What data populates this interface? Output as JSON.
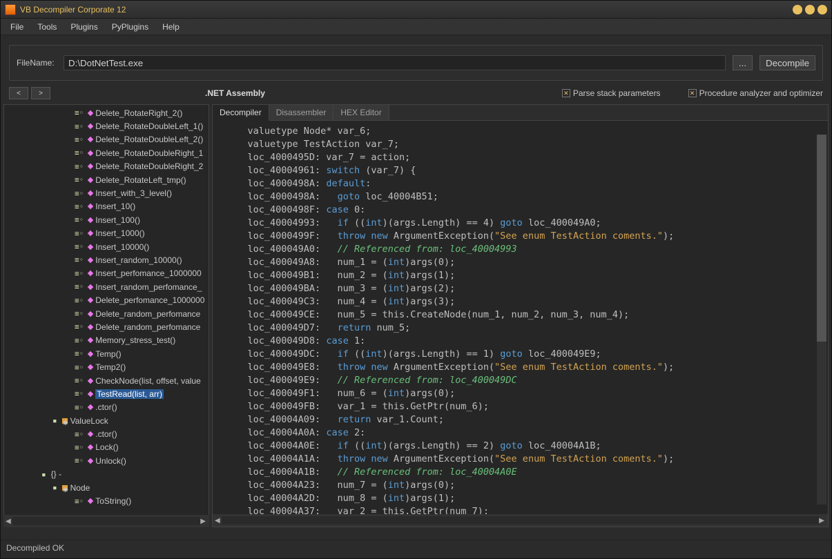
{
  "window": {
    "title": "VB Decompiler Corporate 12"
  },
  "menu": [
    "File",
    "Tools",
    "Plugins",
    "PyPlugins",
    "Help"
  ],
  "filePanel": {
    "label": "FileName:",
    "value": "D:\\DotNetTest.exe",
    "browse": "...",
    "decompile": "Decompile"
  },
  "infoBar": {
    "back": "<",
    "fwd": ">",
    "assembly": ".NET Assembly",
    "check1": "Parse stack parameters",
    "check2": "Procedure analyzer and optimizer"
  },
  "tree": [
    {
      "t": "Delete_RotateRight_2()",
      "k": "m",
      "l": 3
    },
    {
      "t": "Delete_RotateDoubleLeft_1()",
      "k": "m",
      "l": 3
    },
    {
      "t": "Delete_RotateDoubleLeft_2()",
      "k": "m",
      "l": 3
    },
    {
      "t": "Delete_RotateDoubleRight_1",
      "k": "m",
      "l": 3
    },
    {
      "t": "Delete_RotateDoubleRight_2",
      "k": "m",
      "l": 3
    },
    {
      "t": "Delete_RotateLeft_tmp()",
      "k": "m",
      "l": 3
    },
    {
      "t": "Insert_with_3_level()",
      "k": "m",
      "l": 3
    },
    {
      "t": "Insert_10()",
      "k": "m",
      "l": 3
    },
    {
      "t": "Insert_100()",
      "k": "m",
      "l": 3
    },
    {
      "t": "Insert_1000()",
      "k": "m",
      "l": 3
    },
    {
      "t": "Insert_10000()",
      "k": "m",
      "l": 3
    },
    {
      "t": "Insert_random_10000()",
      "k": "m",
      "l": 3
    },
    {
      "t": "Insert_perfomance_1000000",
      "k": "m",
      "l": 3
    },
    {
      "t": "Insert_random_perfomance_",
      "k": "m",
      "l": 3
    },
    {
      "t": "Delete_perfomance_1000000",
      "k": "m",
      "l": 3
    },
    {
      "t": "Delete_random_perfomance",
      "k": "m",
      "l": 3
    },
    {
      "t": "Delete_random_perfomance",
      "k": "m",
      "l": 3
    },
    {
      "t": "Memory_stress_test()",
      "k": "m",
      "l": 3
    },
    {
      "t": "Temp()",
      "k": "m",
      "l": 3
    },
    {
      "t": "Temp2()",
      "k": "m",
      "l": 3
    },
    {
      "t": "CheckNode(list, offset, value",
      "k": "m",
      "l": 3
    },
    {
      "t": "TestRead(list, arr)",
      "k": "m",
      "l": 3,
      "sel": true
    },
    {
      "t": ".ctor()",
      "k": "m",
      "l": 3
    },
    {
      "t": "ValueLock",
      "k": "c",
      "l": 2
    },
    {
      "t": ".ctor()",
      "k": "m",
      "l": 3
    },
    {
      "t": "Lock()",
      "k": "m",
      "l": 3
    },
    {
      "t": "Unlock()",
      "k": "m",
      "l": 3
    },
    {
      "t": "{} -",
      "k": "ns",
      "l": 1
    },
    {
      "t": "Node",
      "k": "c",
      "l": 2
    },
    {
      "t": "ToString()",
      "k": "m",
      "l": 3
    }
  ],
  "tabs": [
    "Decompiler",
    "Disassembler",
    "HEX Editor"
  ],
  "activeTab": 0,
  "code": [
    {
      "ind": 4,
      "seg": [
        {
          "c": "lb",
          "t": "valuetype Node* var_6;"
        }
      ]
    },
    {
      "ind": 4,
      "seg": [
        {
          "c": "lb",
          "t": "valuetype TestAction var_7;"
        }
      ]
    },
    {
      "ind": 0,
      "seg": [
        {
          "c": "lb",
          "t": ""
        }
      ]
    },
    {
      "ind": 4,
      "seg": [
        {
          "c": "lb",
          "t": "loc_4000495D: var_7 = action;"
        }
      ]
    },
    {
      "ind": 4,
      "seg": [
        {
          "c": "lb",
          "t": "loc_40004961: "
        },
        {
          "c": "kw",
          "t": "switch"
        },
        {
          "c": "lb",
          "t": " (var_7) {"
        }
      ]
    },
    {
      "ind": 4,
      "seg": [
        {
          "c": "lb",
          "t": "loc_4000498A: "
        },
        {
          "c": "kw",
          "t": "default"
        },
        {
          "c": "lb",
          "t": ":"
        }
      ]
    },
    {
      "ind": 4,
      "seg": [
        {
          "c": "lb",
          "t": "loc_4000498A:   "
        },
        {
          "c": "kw",
          "t": "goto"
        },
        {
          "c": "lb",
          "t": " loc_40004B51;"
        }
      ]
    },
    {
      "ind": 4,
      "seg": [
        {
          "c": "lb",
          "t": "loc_4000498F: "
        },
        {
          "c": "kw",
          "t": "case"
        },
        {
          "c": "lb",
          "t": " 0:"
        }
      ]
    },
    {
      "ind": 4,
      "seg": [
        {
          "c": "lb",
          "t": "loc_40004993:   "
        },
        {
          "c": "kw",
          "t": "if"
        },
        {
          "c": "lb",
          "t": " (("
        },
        {
          "c": "kw",
          "t": "int"
        },
        {
          "c": "lb",
          "t": ")(args.Length) == 4) "
        },
        {
          "c": "kw",
          "t": "goto"
        },
        {
          "c": "lb",
          "t": " loc_400049A0;"
        }
      ]
    },
    {
      "ind": 4,
      "seg": [
        {
          "c": "lb",
          "t": "loc_4000499F:   "
        },
        {
          "c": "kw",
          "t": "throw"
        },
        {
          "c": "lb",
          "t": " "
        },
        {
          "c": "kw",
          "t": "new"
        },
        {
          "c": "lb",
          "t": " ArgumentException("
        },
        {
          "c": "str",
          "t": "\"See enum TestAction coments.\""
        },
        {
          "c": "lb",
          "t": ");"
        }
      ]
    },
    {
      "ind": 4,
      "seg": [
        {
          "c": "lb",
          "t": "loc_400049A0:   "
        },
        {
          "c": "cmt",
          "t": "// Referenced from: loc_40004993"
        }
      ]
    },
    {
      "ind": 4,
      "seg": [
        {
          "c": "lb",
          "t": "loc_400049A8:   num_1 = ("
        },
        {
          "c": "kw",
          "t": "int"
        },
        {
          "c": "lb",
          "t": ")args(0);"
        }
      ]
    },
    {
      "ind": 4,
      "seg": [
        {
          "c": "lb",
          "t": "loc_400049B1:   num_2 = ("
        },
        {
          "c": "kw",
          "t": "int"
        },
        {
          "c": "lb",
          "t": ")args(1);"
        }
      ]
    },
    {
      "ind": 4,
      "seg": [
        {
          "c": "lb",
          "t": "loc_400049BA:   num_3 = ("
        },
        {
          "c": "kw",
          "t": "int"
        },
        {
          "c": "lb",
          "t": ")args(2);"
        }
      ]
    },
    {
      "ind": 4,
      "seg": [
        {
          "c": "lb",
          "t": "loc_400049C3:   num_4 = ("
        },
        {
          "c": "kw",
          "t": "int"
        },
        {
          "c": "lb",
          "t": ")args(3);"
        }
      ]
    },
    {
      "ind": 4,
      "seg": [
        {
          "c": "lb",
          "t": "loc_400049CE:   num_5 = this.CreateNode(num_1, num_2, num_3, num_4);"
        }
      ]
    },
    {
      "ind": 4,
      "seg": [
        {
          "c": "lb",
          "t": "loc_400049D7:   "
        },
        {
          "c": "kw",
          "t": "return"
        },
        {
          "c": "lb",
          "t": " num_5;"
        }
      ]
    },
    {
      "ind": 4,
      "seg": [
        {
          "c": "lb",
          "t": "loc_400049D8: "
        },
        {
          "c": "kw",
          "t": "case"
        },
        {
          "c": "lb",
          "t": " 1:"
        }
      ]
    },
    {
      "ind": 4,
      "seg": [
        {
          "c": "lb",
          "t": "loc_400049DC:   "
        },
        {
          "c": "kw",
          "t": "if"
        },
        {
          "c": "lb",
          "t": " (("
        },
        {
          "c": "kw",
          "t": "int"
        },
        {
          "c": "lb",
          "t": ")(args.Length) == 1) "
        },
        {
          "c": "kw",
          "t": "goto"
        },
        {
          "c": "lb",
          "t": " loc_400049E9;"
        }
      ]
    },
    {
      "ind": 4,
      "seg": [
        {
          "c": "lb",
          "t": "loc_400049E8:   "
        },
        {
          "c": "kw",
          "t": "throw"
        },
        {
          "c": "lb",
          "t": " "
        },
        {
          "c": "kw",
          "t": "new"
        },
        {
          "c": "lb",
          "t": " ArgumentException("
        },
        {
          "c": "str",
          "t": "\"See enum TestAction coments.\""
        },
        {
          "c": "lb",
          "t": ");"
        }
      ]
    },
    {
      "ind": 4,
      "seg": [
        {
          "c": "lb",
          "t": "loc_400049E9:   "
        },
        {
          "c": "cmt",
          "t": "// Referenced from: loc_400049DC"
        }
      ]
    },
    {
      "ind": 4,
      "seg": [
        {
          "c": "lb",
          "t": "loc_400049F1:   num_6 = ("
        },
        {
          "c": "kw",
          "t": "int"
        },
        {
          "c": "lb",
          "t": ")args(0);"
        }
      ]
    },
    {
      "ind": 4,
      "seg": [
        {
          "c": "lb",
          "t": "loc_400049FB:   var_1 = this.GetPtr(num_6);"
        }
      ]
    },
    {
      "ind": 4,
      "seg": [
        {
          "c": "lb",
          "t": "loc_40004A09:   "
        },
        {
          "c": "kw",
          "t": "return"
        },
        {
          "c": "lb",
          "t": " var_1.Count;"
        }
      ]
    },
    {
      "ind": 4,
      "seg": [
        {
          "c": "lb",
          "t": "loc_40004A0A: "
        },
        {
          "c": "kw",
          "t": "case"
        },
        {
          "c": "lb",
          "t": " 2:"
        }
      ]
    },
    {
      "ind": 4,
      "seg": [
        {
          "c": "lb",
          "t": "loc_40004A0E:   "
        },
        {
          "c": "kw",
          "t": "if"
        },
        {
          "c": "lb",
          "t": " (("
        },
        {
          "c": "kw",
          "t": "int"
        },
        {
          "c": "lb",
          "t": ")(args.Length) == 2) "
        },
        {
          "c": "kw",
          "t": "goto"
        },
        {
          "c": "lb",
          "t": " loc_40004A1B;"
        }
      ]
    },
    {
      "ind": 4,
      "seg": [
        {
          "c": "lb",
          "t": "loc_40004A1A:   "
        },
        {
          "c": "kw",
          "t": "throw"
        },
        {
          "c": "lb",
          "t": " "
        },
        {
          "c": "kw",
          "t": "new"
        },
        {
          "c": "lb",
          "t": " ArgumentException("
        },
        {
          "c": "str",
          "t": "\"See enum TestAction coments.\""
        },
        {
          "c": "lb",
          "t": ");"
        }
      ]
    },
    {
      "ind": 4,
      "seg": [
        {
          "c": "lb",
          "t": "loc_40004A1B:   "
        },
        {
          "c": "cmt",
          "t": "// Referenced from: loc_40004A0E"
        }
      ]
    },
    {
      "ind": 4,
      "seg": [
        {
          "c": "lb",
          "t": "loc_40004A23:   num_7 = ("
        },
        {
          "c": "kw",
          "t": "int"
        },
        {
          "c": "lb",
          "t": ")args(0);"
        }
      ]
    },
    {
      "ind": 4,
      "seg": [
        {
          "c": "lb",
          "t": "loc_40004A2D:   num_8 = ("
        },
        {
          "c": "kw",
          "t": "int"
        },
        {
          "c": "lb",
          "t": ")args(1);"
        }
      ]
    },
    {
      "ind": 4,
      "seg": [
        {
          "c": "lb",
          "t": "loc_40004A37:   var_2 = this.GetPtr(num_7);"
        }
      ]
    }
  ],
  "status": "Decompiled OK"
}
